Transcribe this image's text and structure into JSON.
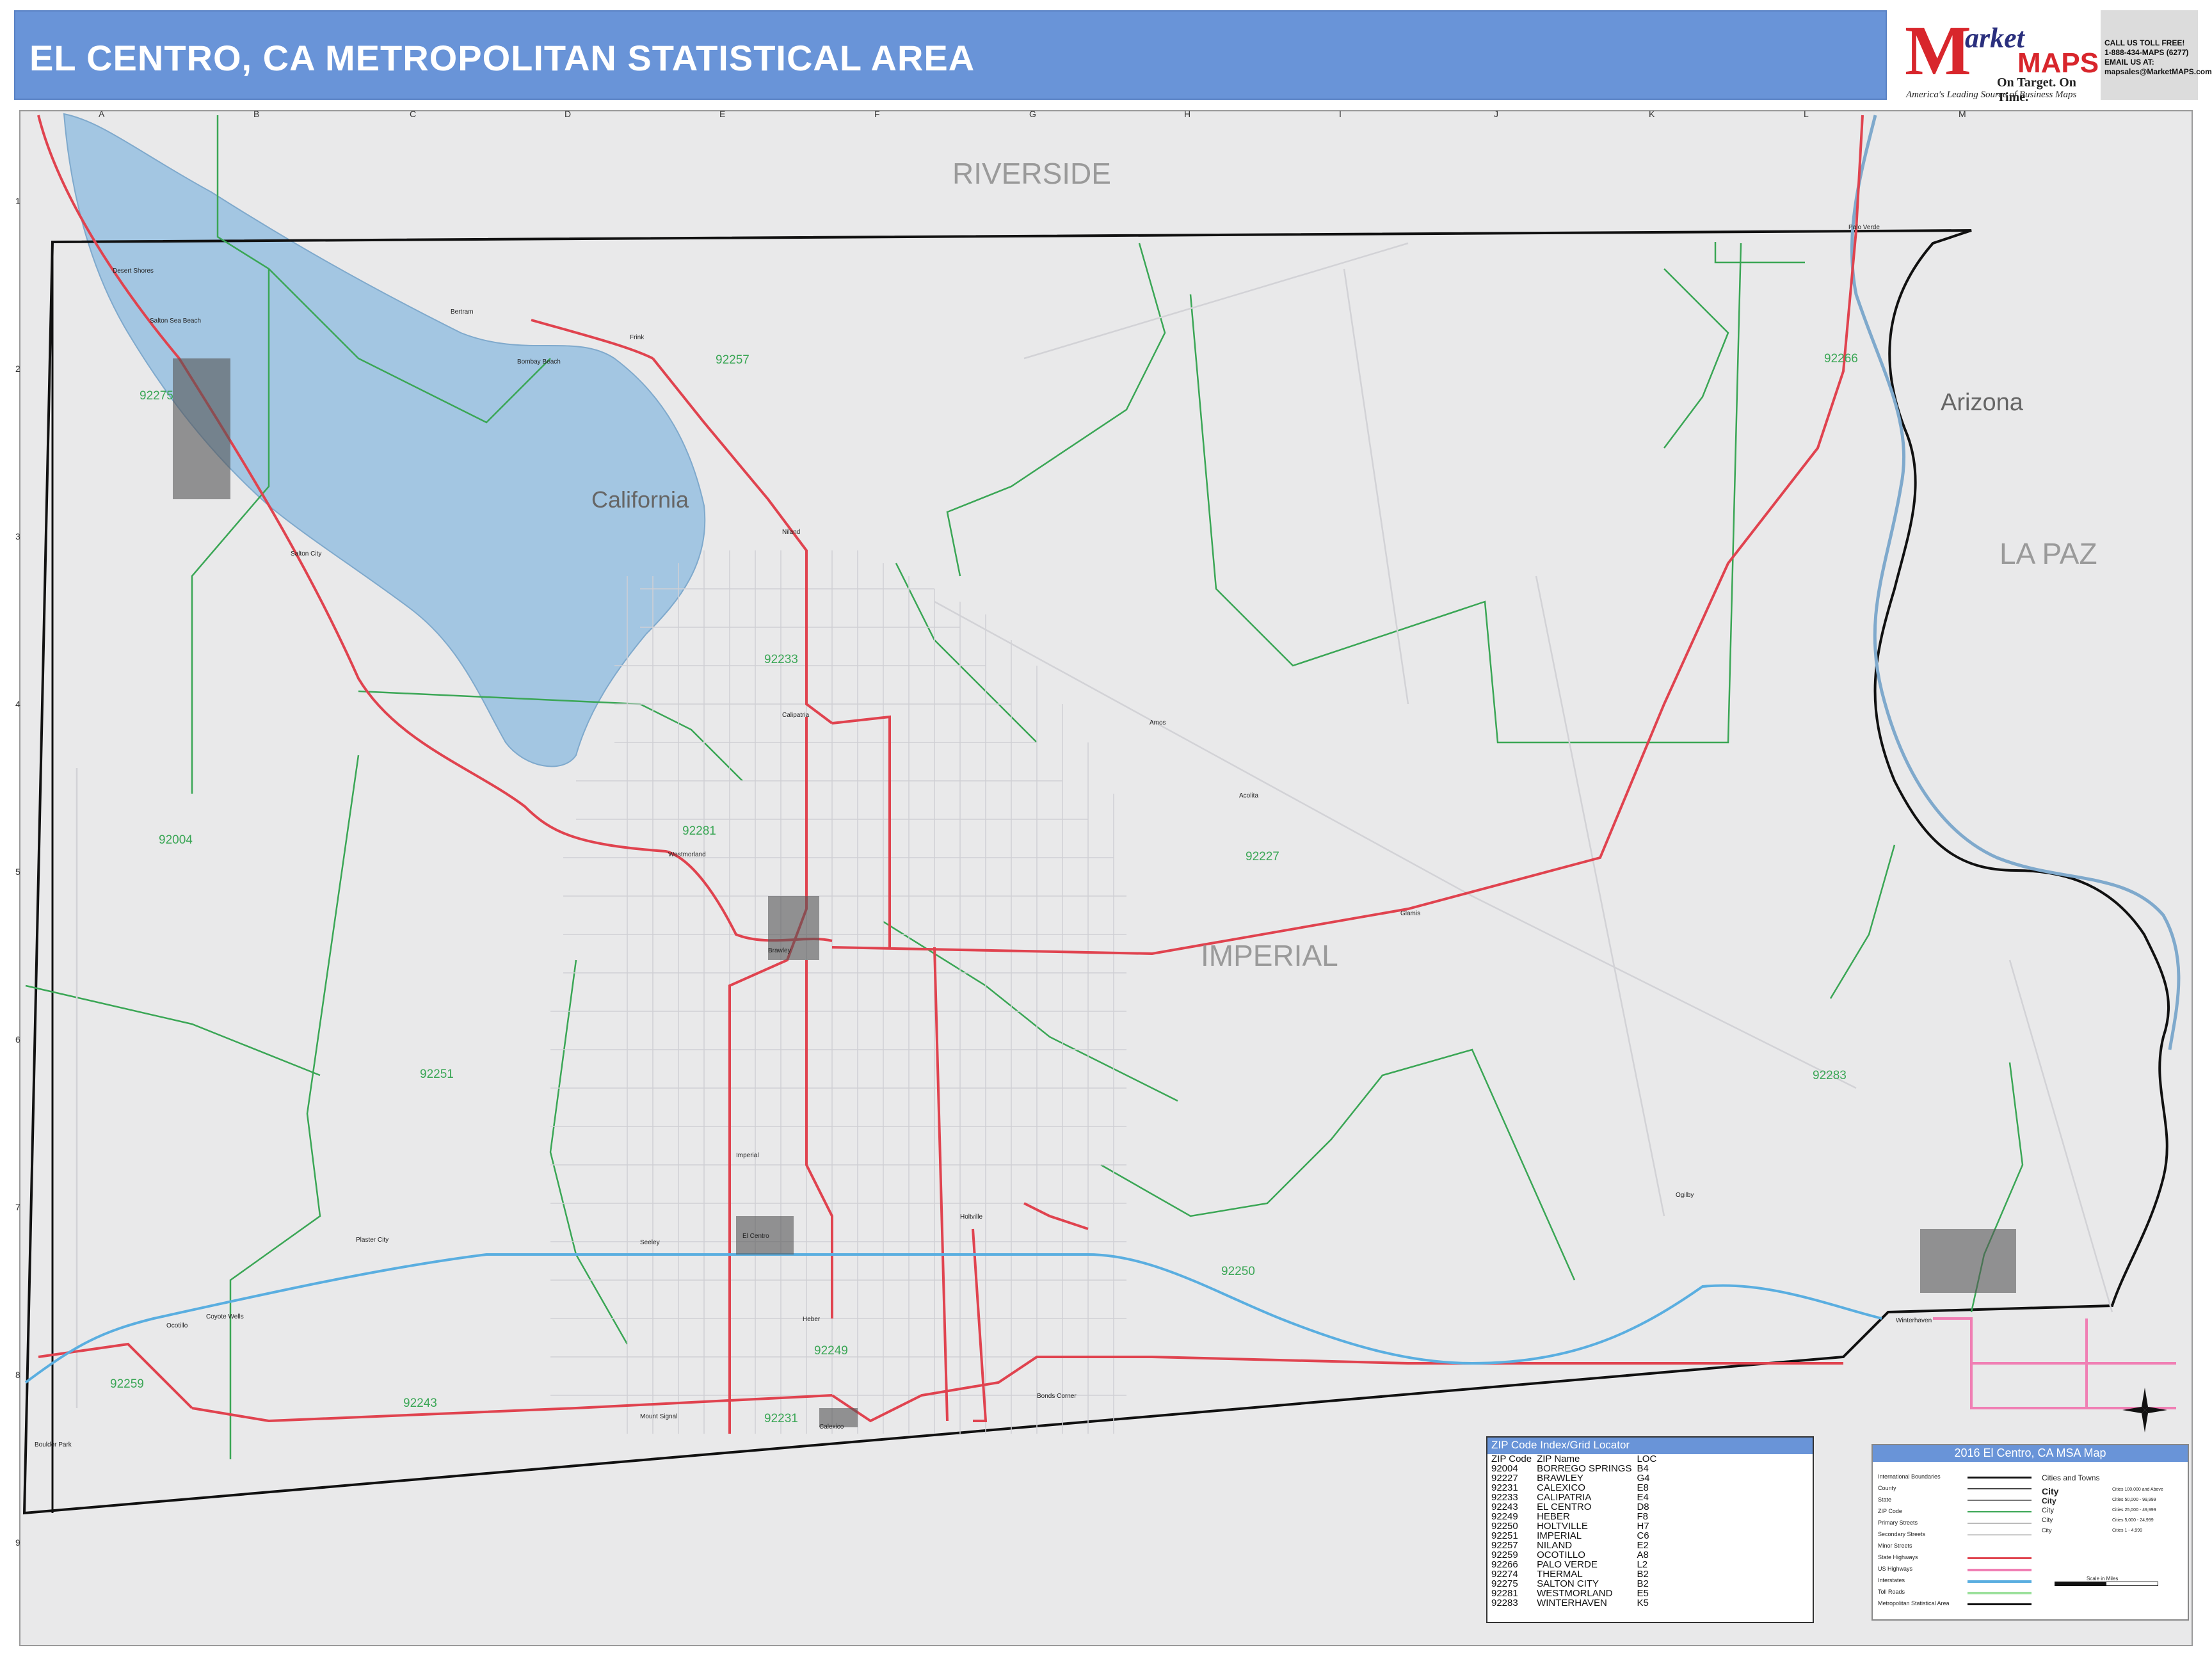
{
  "header": {
    "title": "EL CENTRO, CA METROPOLITAN STATISTICAL AREA",
    "logo_initial": "M",
    "logo_market": "arket",
    "logo_maps": "MAPS",
    "logo_slogan": "On Target. On Time.",
    "logo_tagline": "America's Leading Source of Business Maps",
    "contact": [
      "CALL US TOLL FREE!",
      "1-888-434-MAPS (6277)",
      "EMAIL US AT:",
      "mapsales@MarketMAPS.com"
    ]
  },
  "grid": {
    "columns": [
      "A",
      "B",
      "C",
      "D",
      "E",
      "F",
      "G",
      "H",
      "I",
      "J",
      "K",
      "L",
      "M"
    ],
    "rows": [
      "1",
      "2",
      "3",
      "4",
      "5",
      "6",
      "7",
      "8",
      "9"
    ]
  },
  "regions": {
    "riverside": "RIVERSIDE",
    "arizona": "Arizona",
    "la_paz": "LA PAZ",
    "california": "California",
    "imperial": "IMPERIAL"
  },
  "zip_labels": [
    "92257",
    "92233",
    "92281",
    "92004",
    "92227",
    "92251",
    "92250",
    "92249",
    "92243",
    "92259",
    "92231",
    "92283",
    "92266",
    "92275"
  ],
  "places": [
    "Desert Shores",
    "Salton Sea Beach",
    "Bombay Beach",
    "Bertram",
    "Frink",
    "Salton City",
    "Niland",
    "Calipatria",
    "Westmorland",
    "Brawley",
    "Imperial",
    "El Centro",
    "Heber",
    "Calexico",
    "Holtville",
    "Seeley",
    "Ocotillo",
    "Plaster City",
    "Coyote Wells",
    "Boulder Park",
    "Winterhaven",
    "Glamis",
    "Ogilby",
    "Palo Verde",
    "Acolita",
    "Mount Signal",
    "Bonds Corner",
    "Amos"
  ],
  "zip_index": {
    "title": "ZIP Code Index/Grid Locator",
    "headers": [
      "ZIP Code",
      "ZIP Name",
      "LOC"
    ],
    "rows": [
      [
        "92004",
        "BORREGO SPRINGS",
        "B4"
      ],
      [
        "92227",
        "BRAWLEY",
        "G4"
      ],
      [
        "92231",
        "CALEXICO",
        "E8"
      ],
      [
        "92233",
        "CALIPATRIA",
        "E4"
      ],
      [
        "92243",
        "EL CENTRO",
        "D8"
      ],
      [
        "92249",
        "HEBER",
        "F8"
      ],
      [
        "92250",
        "HOLTVILLE",
        "H7"
      ],
      [
        "92251",
        "IMPERIAL",
        "C6"
      ],
      [
        "92257",
        "NILAND",
        "E2"
      ],
      [
        "92259",
        "OCOTILLO",
        "A8"
      ],
      [
        "92266",
        "PALO VERDE",
        "L2"
      ],
      [
        "92274",
        "THERMAL",
        "B2"
      ],
      [
        "92275",
        "SALTON CITY",
        "B2"
      ],
      [
        "92281",
        "WESTMORLAND",
        "E5"
      ],
      [
        "92283",
        "WINTERHAVEN",
        "K5"
      ]
    ]
  },
  "legend": {
    "title": "2016 El Centro, CA MSA Map",
    "items": [
      "International Boundaries",
      "County",
      "State",
      "ZIP Code",
      "Primary Streets",
      "Secondary Streets",
      "Minor Streets",
      "State Highways",
      "US Highways",
      "Interstates",
      "Toll Roads",
      "Metropolitan Statistical Area"
    ],
    "cities_title": "Cities and Towns",
    "city_classes": [
      "City",
      "City",
      "City",
      "City",
      "City"
    ],
    "city_ranges": [
      "Cities 100,000 and Above",
      "Cities 50,000 - 99,999",
      "Cities 25,000 - 49,999",
      "Cities 5,000 - 24,999",
      "Cities 1 - 4,999"
    ],
    "scale": "Scale in Miles"
  },
  "colors": {
    "title_bar": "#6994d8",
    "water": "#a3c6e2",
    "land": "#e9e9ea",
    "zip_boundary": "#3aa655",
    "highway": "#e0434f",
    "interstate": "#5aaee0",
    "county_line": "#111111"
  }
}
